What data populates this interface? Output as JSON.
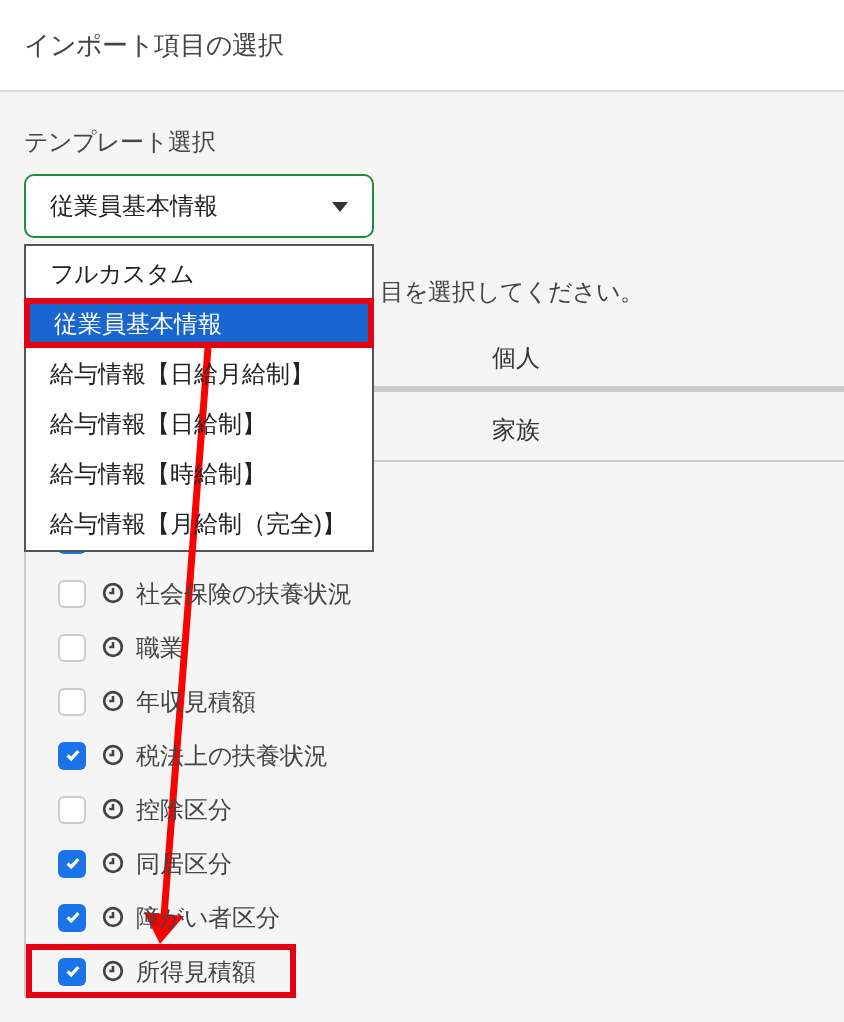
{
  "dialog": {
    "title": "インポート項目の選択"
  },
  "template": {
    "label": "テンプレート選択",
    "value": "従業員基本情報",
    "menu": [
      {
        "label": "フルカスタム",
        "selected": false,
        "highlighted": false
      },
      {
        "label": "従業員基本情報",
        "selected": true,
        "highlighted": true
      },
      {
        "label": "給与情報【日給月給制】",
        "selected": false,
        "highlighted": false
      },
      {
        "label": "給与情報【日給制】",
        "selected": false,
        "highlighted": false
      },
      {
        "label": "給与情報【時給制】",
        "selected": false,
        "highlighted": false
      },
      {
        "label": "給与情報【月給制（完全)】",
        "selected": false,
        "highlighted": false
      }
    ]
  },
  "instruction": "目を選択してください。",
  "sections": [
    {
      "label": "個人"
    },
    {
      "label": "家族"
    }
  ],
  "fields": [
    {
      "checked": true
    },
    {
      "label": "社会保険の扶養状況",
      "checked": false
    },
    {
      "label": "職業",
      "checked": false
    },
    {
      "label": "年収見積額",
      "checked": false
    },
    {
      "label": "税法上の扶養状況",
      "checked": true
    },
    {
      "label": "控除区分",
      "checked": false
    },
    {
      "label": "同居区分",
      "checked": true
    },
    {
      "label": "障がい者区分",
      "checked": true
    },
    {
      "label": "所得見積額",
      "checked": true,
      "highlighted": true
    }
  ]
}
